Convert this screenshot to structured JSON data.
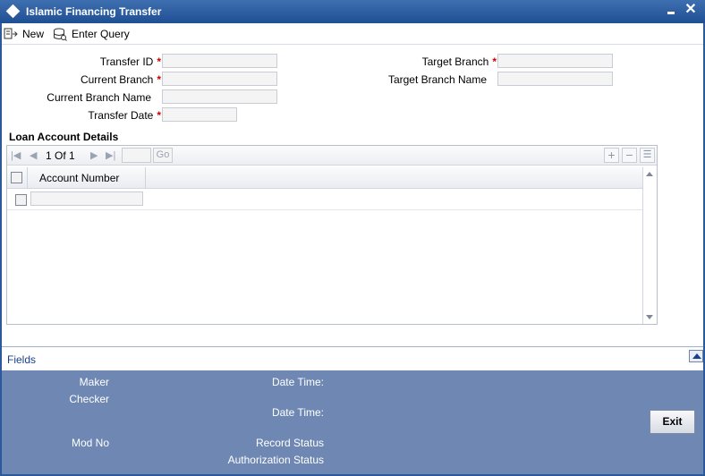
{
  "window": {
    "title": "Islamic Financing Transfer"
  },
  "toolbar": {
    "new_label": "New",
    "enter_query_label": "Enter Query"
  },
  "form": {
    "transfer_id_label": "Transfer ID",
    "current_branch_label": "Current Branch",
    "current_branch_name_label": "Current Branch Name",
    "transfer_date_label": "Transfer Date",
    "target_branch_label": "Target Branch",
    "target_branch_name_label": "Target Branch Name",
    "required_mark": "*",
    "transfer_id_value": "",
    "current_branch_value": "",
    "current_branch_name_value": "",
    "transfer_date_value": "",
    "target_branch_value": "",
    "target_branch_name_value": ""
  },
  "loan_section": {
    "title": "Loan Account Details",
    "pagination": {
      "current": "1",
      "of_label": "Of",
      "total": "1",
      "go_label": "Go"
    },
    "columns": [
      "Account Number"
    ],
    "rows": [
      {
        "account_number": ""
      }
    ]
  },
  "fields_bar": {
    "label": "Fields"
  },
  "audit": {
    "maker_label": "Maker",
    "checker_label": "Checker",
    "date_time_label": "Date Time:",
    "mod_no_label": "Mod No",
    "record_status_label": "Record Status",
    "authorization_status_label": "Authorization Status",
    "exit_label": "Exit"
  },
  "colors": {
    "titlebar": "#2a5a9c",
    "footer": "#6e88b3",
    "required": "#cc0000",
    "link": "#1b3f8a"
  }
}
